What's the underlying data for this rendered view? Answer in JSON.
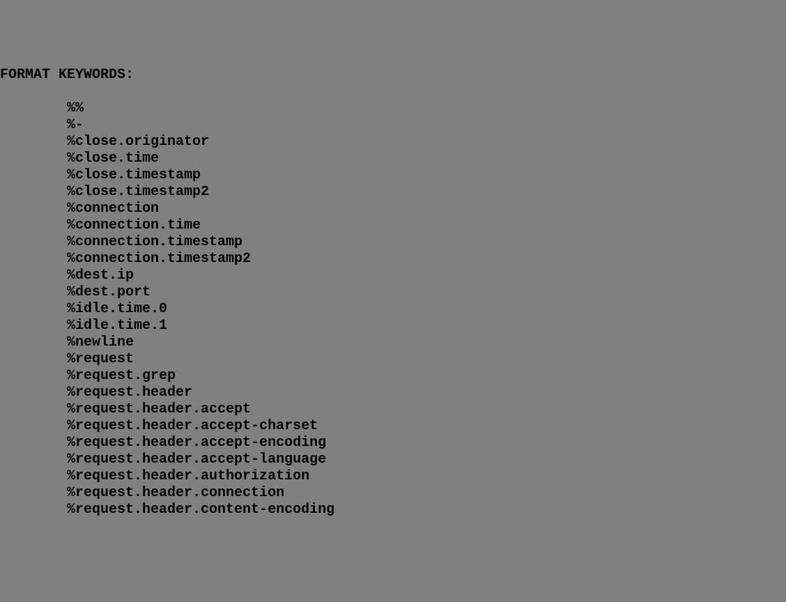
{
  "heading": "FORMAT KEYWORDS:",
  "keywords": [
    "%%",
    "%-",
    "%close.originator",
    "%close.time",
    "%close.timestamp",
    "%close.timestamp2",
    "%connection",
    "%connection.time",
    "%connection.timestamp",
    "%connection.timestamp2",
    "%dest.ip",
    "%dest.port",
    "%idle.time.0",
    "%idle.time.1",
    "%newline",
    "%request",
    "%request.grep",
    "%request.header",
    "%request.header.accept",
    "%request.header.accept-charset",
    "%request.header.accept-encoding",
    "%request.header.accept-language",
    "%request.header.authorization",
    "%request.header.connection",
    "%request.header.content-encoding"
  ]
}
